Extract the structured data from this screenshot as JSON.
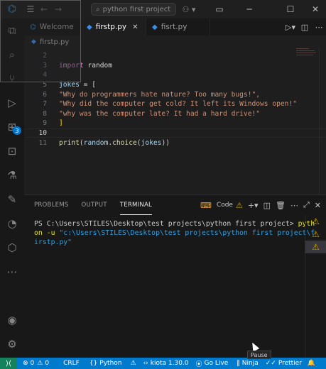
{
  "titlebar": {
    "search_placeholder": "python first project",
    "menu_icon": "hamburger-icon",
    "back_icon": "arrow-left-icon",
    "forward_icon": "arrow-right-icon"
  },
  "activity_bar": {
    "items": [
      {
        "icon": "files-icon"
      },
      {
        "icon": "search-icon"
      },
      {
        "icon": "source-control-icon"
      },
      {
        "icon": "run-debug-icon"
      },
      {
        "icon": "extensions-icon",
        "badge": "3"
      },
      {
        "icon": "remote-explorer-icon"
      },
      {
        "icon": "testing-icon"
      },
      {
        "icon": "paintbrush-icon"
      },
      {
        "icon": "edge-icon"
      },
      {
        "icon": "package-icon"
      },
      {
        "icon": "more-icon"
      }
    ],
    "account_icon": "account-icon",
    "settings_icon": "gear-icon"
  },
  "tabs": [
    {
      "label": "Welcome",
      "active": false
    },
    {
      "label": "firstp.py",
      "active": true
    },
    {
      "label": "fisrt.py",
      "active": false
    }
  ],
  "breadcrumb": {
    "file": "firstp.py"
  },
  "editor": {
    "lines": [
      {
        "n": "2",
        "text": ""
      },
      {
        "n": "3",
        "text": "import random"
      },
      {
        "n": "4",
        "text": ""
      },
      {
        "n": "5",
        "text": "jokes = ["
      },
      {
        "n": "6",
        "text": "\"Why do programmers hate nature? Too many bugs!\","
      },
      {
        "n": "7",
        "text": "\"Why did the computer get cold? It left its Windows open!\""
      },
      {
        "n": "8",
        "text": "\"why was the computer late? It had a hard drive!\""
      },
      {
        "n": "9",
        "text": "]"
      },
      {
        "n": "10",
        "text": ""
      },
      {
        "n": "11",
        "text": "print(random.choice(jokes))"
      }
    ]
  },
  "panel": {
    "tabs": [
      "PROBLEMS",
      "OUTPUT",
      "TERMINAL"
    ],
    "active_tab": "TERMINAL",
    "code_label": "Code",
    "terminal": {
      "prompt": "PS C:\\Users\\STILES\\Desktop\\test projects\\python first project>",
      "command": "pyth",
      "line2_cmd": "on -u",
      "path_part1": "\"c:\\Users\\STILES\\Desktop\\test projects\\python first project\\f",
      "path_part2": "irstp.py\""
    }
  },
  "statusbar": {
    "errors": "0",
    "warnings": "0",
    "eol": "CRLF",
    "language": "Python",
    "kiota": "kiota 1.30.0",
    "golive": "Go Live",
    "ninja": "Ninja",
    "prettier": "Prettier"
  },
  "tooltip": "Pause"
}
